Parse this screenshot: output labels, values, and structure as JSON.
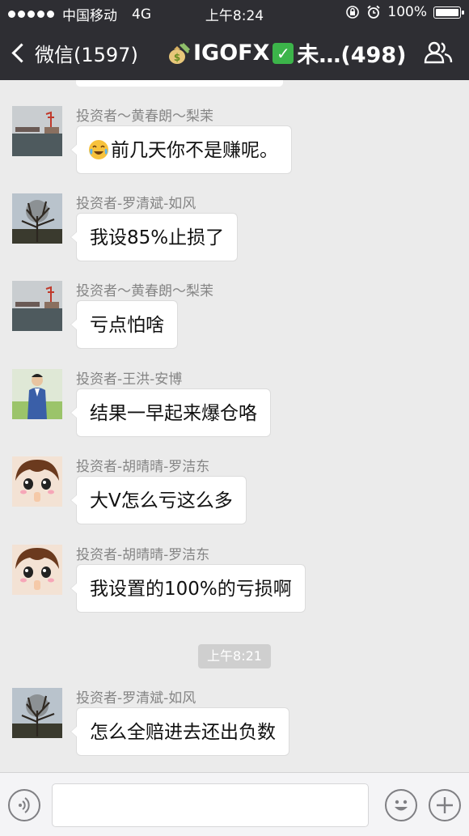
{
  "status_bar": {
    "carrier": "中国移动",
    "network": "4G",
    "time": "上午8:24",
    "battery": "100%"
  },
  "nav": {
    "back_label": "微信(1597)",
    "title_prefix": "IGOFX",
    "title_suffix": "未…(498)",
    "icons": [
      "back-chevron-icon",
      "money-bag-emoji-icon",
      "check-mark-emoji-icon",
      "group-members-icon"
    ]
  },
  "messages": [
    {
      "sender": "投资者～黄春朗～梨茉",
      "text": "前几天你不是赚呢。",
      "emoji": "crying-laughing-emoji"
    },
    {
      "sender": "投资者-罗清斌-如风",
      "text": "我设85%止损了"
    },
    {
      "sender": "投资者～黄春朗～梨茉",
      "text": "亏点怕啥"
    },
    {
      "sender": "投资者-王洪-安博",
      "text": "结果一早起来爆仓咯"
    },
    {
      "sender": "投资者-胡晴晴-罗洁东",
      "text": "大V怎么亏这么多"
    },
    {
      "sender": "投资者-胡晴晴-罗洁东",
      "text": "我设置的100%的亏损啊"
    },
    {
      "sender": "投资者-罗清斌-如风",
      "text": "怎么全赔进去还出负数"
    }
  ],
  "timestamp": "上午8:21",
  "input_bar": {
    "icons": [
      "voice-icon",
      "emoji-icon",
      "plus-icon"
    ],
    "value": ""
  }
}
